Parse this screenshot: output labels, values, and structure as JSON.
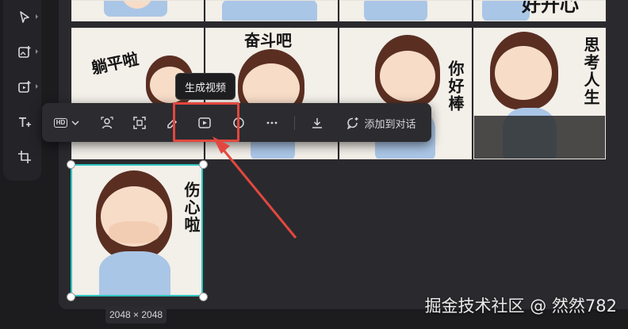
{
  "rail": {
    "tools": [
      {
        "name": "select-tool",
        "icon": "cursor-icon"
      },
      {
        "name": "image-add-tool",
        "icon": "image-plus-icon"
      },
      {
        "name": "video-add-tool",
        "icon": "video-plus-icon"
      },
      {
        "name": "text-tool",
        "icon": "text-plus-icon"
      },
      {
        "name": "crop-tool",
        "icon": "crop-icon"
      }
    ]
  },
  "grid": {
    "cells": [
      {
        "caption": "躺平啦"
      },
      {
        "caption": "奋斗吧"
      },
      {
        "caption": "你好棒"
      },
      {
        "caption": "思考人生"
      }
    ],
    "top_caption": "好开心",
    "selected_caption": "伤心啦"
  },
  "toolbar": {
    "hd_label": "HD",
    "tooltip": "生成视频",
    "add_to_chat": "添加到对话"
  },
  "selection": {
    "dimensions": "2048 × 2048"
  },
  "watermark": "掘金技术社区 @ 然然782",
  "colors": {
    "highlight": "#e2473f",
    "selection": "#2fc6c1"
  }
}
